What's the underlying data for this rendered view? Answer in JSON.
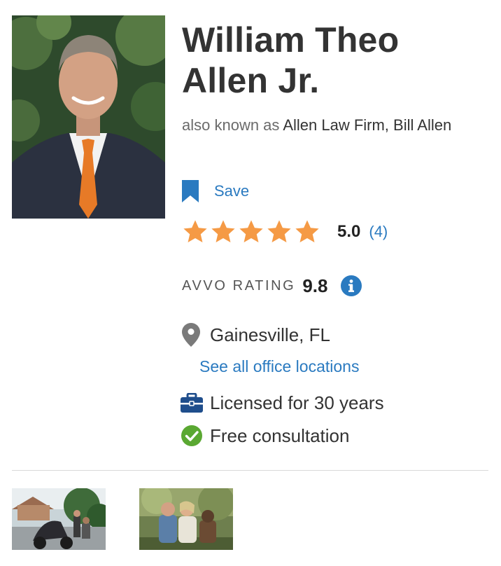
{
  "profile": {
    "name_line1": "William Theo",
    "name_line2": "Allen Jr.",
    "aka_prefix": "also known as",
    "aka_names": "Allen Law Firm, Bill Allen"
  },
  "actions": {
    "save_label": "Save"
  },
  "reviews": {
    "stars": 5,
    "score": "5.0",
    "count": "(4)"
  },
  "avvo": {
    "label": "AVVO RATING",
    "score": "9.8"
  },
  "location": {
    "city": "Gainesville, FL",
    "office_link": "See all office locations"
  },
  "licensed": {
    "text": "Licensed for 30 years"
  },
  "consultation": {
    "text": "Free consultation"
  },
  "colors": {
    "accent_blue": "#2a7ac0",
    "star_orange": "#f59a45",
    "check_green": "#5aa832",
    "briefcase_navy": "#1f4e8c",
    "bookmark_blue": "#2a7ac0"
  },
  "icons": [
    "bookmark-icon",
    "star-icon",
    "info-icon",
    "location-pin-icon",
    "briefcase-icon",
    "check-circle-icon"
  ]
}
